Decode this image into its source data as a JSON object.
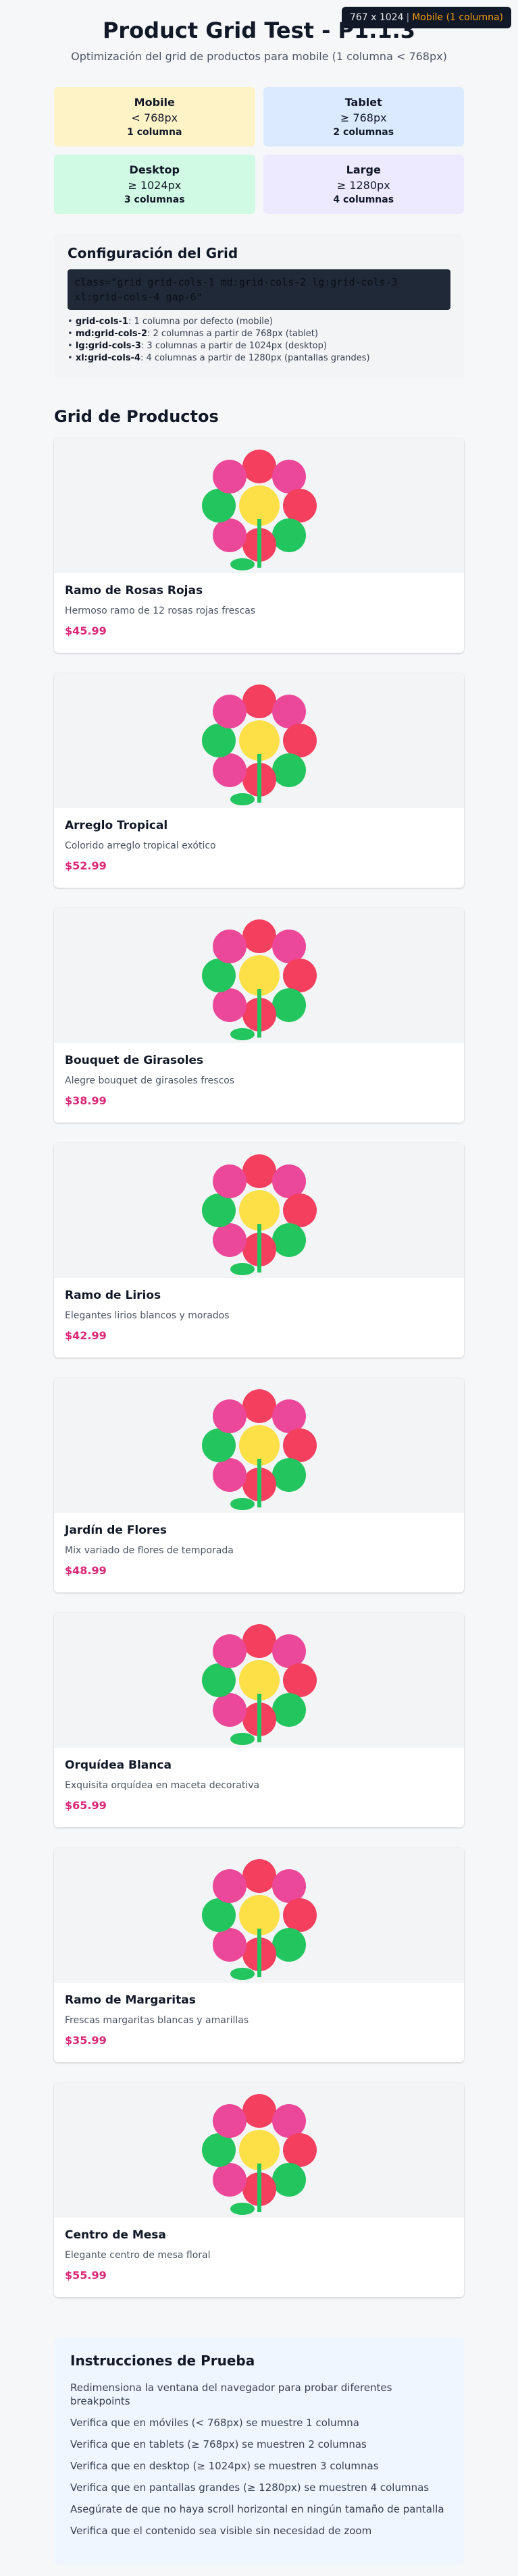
{
  "viewport": {
    "size": "767 x 1024",
    "separator": "|",
    "mode": "Mobile (1 columna)"
  },
  "header": {
    "title": "Product Grid Test - P1.1.3",
    "subtitle": "Optimización del grid de productos para mobile (1 columna < 768px)"
  },
  "breakpoints": [
    {
      "name": "Mobile",
      "px": "< 768px",
      "cols": "1 columna"
    },
    {
      "name": "Tablet",
      "px": "≥ 768px",
      "cols": "2 columnas"
    },
    {
      "name": "Desktop",
      "px": "≥ 1024px",
      "cols": "3 columnas"
    },
    {
      "name": "Large",
      "px": "≥ 1280px",
      "cols": "4 columnas"
    }
  ],
  "config": {
    "title": "Configuración del Grid",
    "code": "class=\"grid grid-cols-1 md:grid-cols-2 lg:grid-cols-3 xl:grid-cols-4 gap-6\"",
    "items": [
      {
        "k": "grid-cols-1",
        "v": ": 1 columna por defecto (mobile)"
      },
      {
        "k": "md:grid-cols-2",
        "v": ": 2 columnas a partir de 768px (tablet)"
      },
      {
        "k": "lg:grid-cols-3",
        "v": ": 3 columnas a partir de 1024px (desktop)"
      },
      {
        "k": "xl:grid-cols-4",
        "v": ": 4 columnas a partir de 1280px (pantallas grandes)"
      }
    ]
  },
  "section_title": "Grid de Productos",
  "products": [
    {
      "name": "Ramo de Rosas Rojas",
      "desc": "Hermoso ramo de 12 rosas rojas frescas",
      "price": "$45.99"
    },
    {
      "name": "Arreglo Tropical",
      "desc": "Colorido arreglo tropical exótico",
      "price": "$52.99"
    },
    {
      "name": "Bouquet de Girasoles",
      "desc": "Alegre bouquet de girasoles frescos",
      "price": "$38.99"
    },
    {
      "name": "Ramo de Lirios",
      "desc": "Elegantes lirios blancos y morados",
      "price": "$42.99"
    },
    {
      "name": "Jardín de Flores",
      "desc": "Mix variado de flores de temporada",
      "price": "$48.99"
    },
    {
      "name": "Orquídea Blanca",
      "desc": "Exquisita orquídea en maceta decorativa",
      "price": "$65.99"
    },
    {
      "name": "Ramo de Margaritas",
      "desc": "Frescas margaritas blancas y amarillas",
      "price": "$35.99"
    },
    {
      "name": "Centro de Mesa",
      "desc": "Elegante centro de mesa floral",
      "price": "$55.99"
    }
  ],
  "instructions": {
    "title": "Instrucciones de Prueba",
    "items": [
      "Redimensiona la ventana del navegador para probar diferentes breakpoints",
      "Verifica que en móviles (< 768px) se muestre 1 columna",
      "Verifica que en tablets (≥ 768px) se muestren 2 columnas",
      "Verifica que en desktop (≥ 1024px) se muestren 3 columnas",
      "Verifica que en pantallas grandes (≥ 1280px) se muestren 4 columnas",
      "Asegúrate de que no haya scroll horizontal en ningún tamaño de pantalla",
      "Verifica que el contenido sea visible sin necesidad de zoom"
    ]
  },
  "colors": {
    "price": "#db2777",
    "mobile": "#fef3c7",
    "tablet": "#dbeafe",
    "desktop": "#d1fae5",
    "large": "#ede9fe"
  }
}
